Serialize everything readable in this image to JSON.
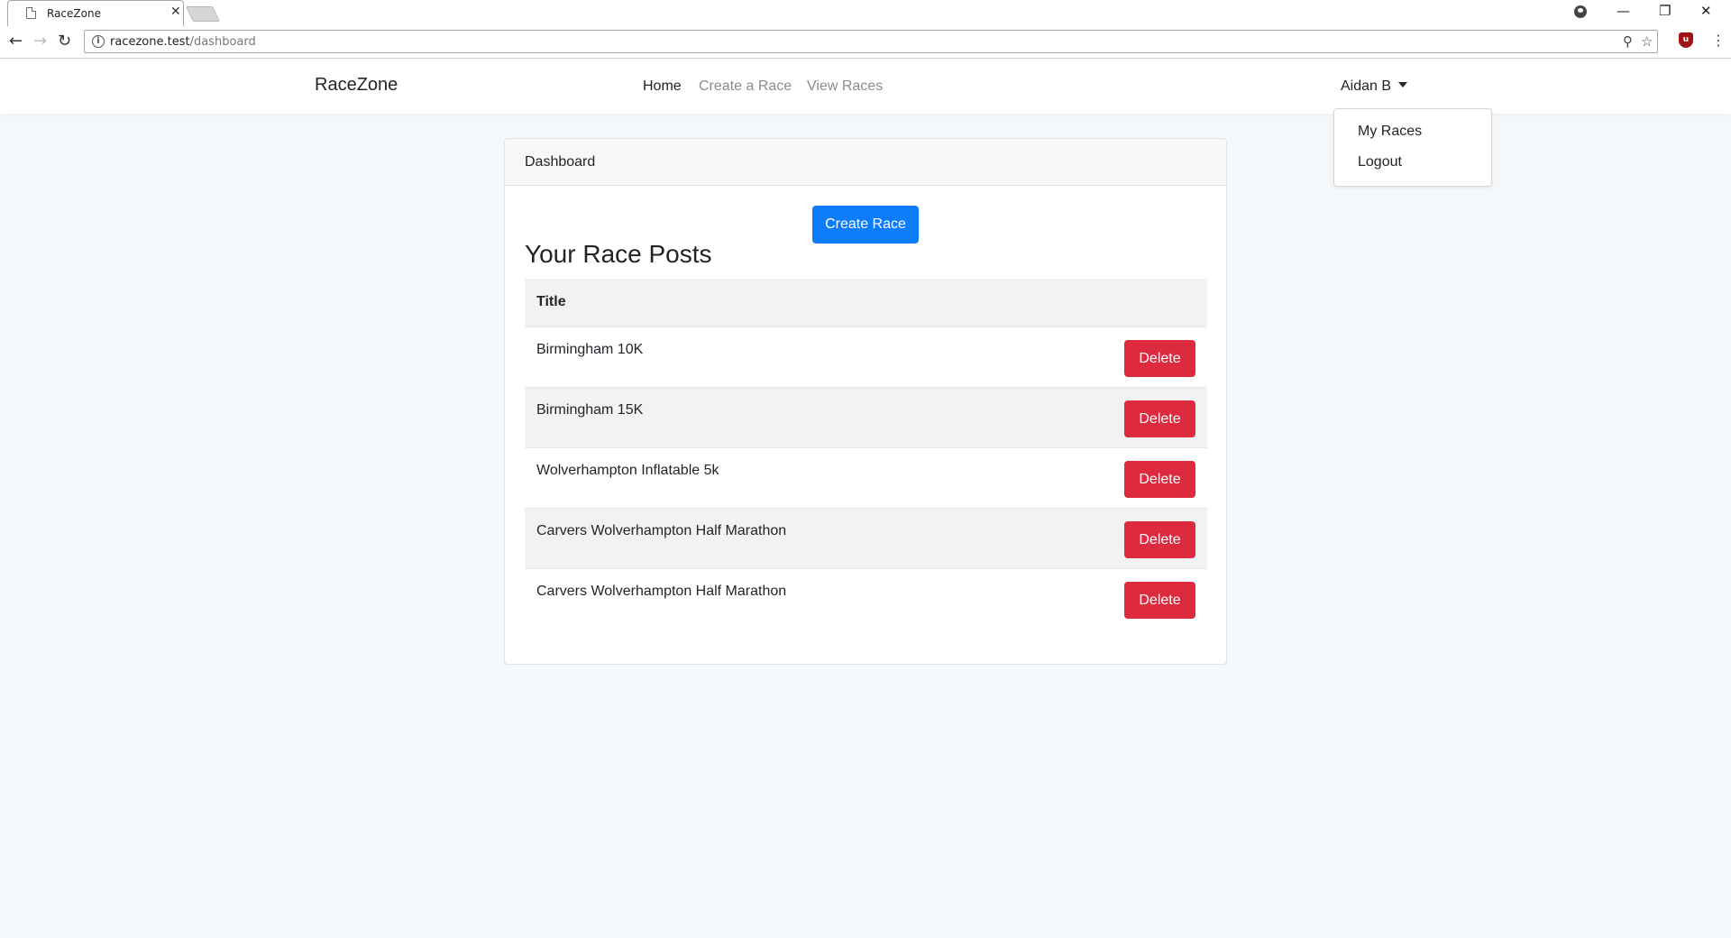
{
  "browser": {
    "tab_title": "RaceZone",
    "tab_close": "✕",
    "url_host": "racezone.test",
    "url_path": "/dashboard",
    "icons": [
      "page-icon",
      "profile-icon",
      "minimize-icon",
      "restore-icon",
      "close-icon",
      "back-icon",
      "forward-icon",
      "reload-icon",
      "info-icon",
      "zoom-icon",
      "star-icon",
      "ublock-icon",
      "menu-icon"
    ]
  },
  "navbar": {
    "brand": "RaceZone",
    "links": [
      {
        "label": "Home",
        "active": true
      },
      {
        "label": "Create a Race",
        "active": false
      },
      {
        "label": "View Races",
        "active": false
      }
    ],
    "user": "Aidan B"
  },
  "user_menu": {
    "items": [
      "My Races",
      "Logout"
    ]
  },
  "card": {
    "header": "Dashboard",
    "create_button": "Create Race",
    "section_title": "Your Race Posts",
    "table": {
      "columns": [
        "Title"
      ],
      "rows": [
        {
          "title": "Birmingham 10K",
          "action": "Delete"
        },
        {
          "title": "Birmingham 15K",
          "action": "Delete"
        },
        {
          "title": "Wolverhampton Inflatable 5k",
          "action": "Delete"
        },
        {
          "title": "Carvers Wolverhampton Half Marathon",
          "action": "Delete"
        },
        {
          "title": "Carvers Wolverhampton Half Marathon",
          "action": "Delete"
        }
      ]
    }
  },
  "colors": {
    "primary": "#0d7dfb",
    "danger": "#dd2a3e",
    "background": "#f5f8fa"
  }
}
